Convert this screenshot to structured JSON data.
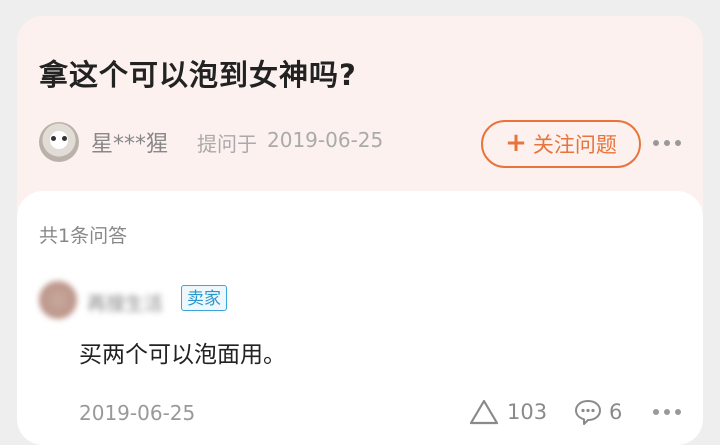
{
  "question": {
    "title": "拿这个可以泡到女神吗?",
    "asker": "星***猩",
    "asked_label": "提问于",
    "asked_date": "2019-06-25",
    "follow_label": "关注问题",
    "follow_icon": "plus-icon"
  },
  "answers": {
    "count_label": "共1条问答",
    "items": [
      {
        "name": "再搜生活",
        "badge": "卖家",
        "text": "买两个可以泡面用。",
        "date": "2019-06-25",
        "likes": "103",
        "comments": "6"
      }
    ]
  },
  "colors": {
    "accent": "#e8743b",
    "badge": "#2a96cc",
    "question_bg": "#fcf1ee"
  }
}
